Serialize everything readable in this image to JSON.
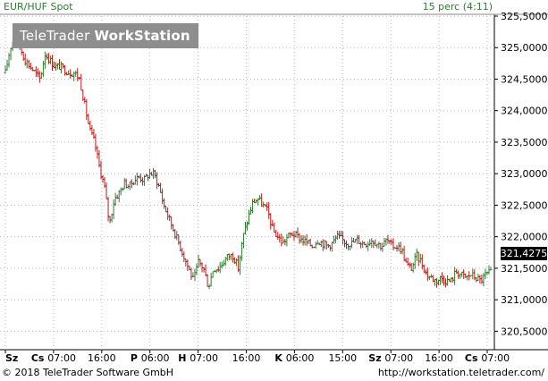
{
  "header": {
    "instrument": "EUR/HUF Spot",
    "interval": "15 perc (4:11)"
  },
  "watermark": {
    "brand": "TeleTrader",
    "product": "WorkStation"
  },
  "footer": {
    "copyright": "© 2018 TeleTrader Software GmbH",
    "url": "http://workstation.teletrader.com/"
  },
  "colors": {
    "up_bar": "#2e7d32",
    "down_bar": "#b71c1c",
    "grid": "#b8b8b8",
    "watermark_bg": "#8e8e8e",
    "last_price_box": "#000000"
  },
  "chart_data": {
    "type": "ohlc",
    "title": "EUR/HUF Spot",
    "xlabel": "",
    "ylabel": "",
    "ylim": [
      320.25,
      325.5
    ],
    "y_ticks": [
      "325,5000",
      "325,0000",
      "324,5000",
      "324,0000",
      "323,5000",
      "323,0000",
      "322,5000",
      "322,0000",
      "321,5000",
      "321,0000",
      "320,5000"
    ],
    "y_tick_values": [
      325.5,
      325.0,
      324.5,
      324.0,
      323.5,
      323.0,
      322.5,
      322.0,
      321.5,
      321.0,
      320.5
    ],
    "x_tick_labels": [
      {
        "day": "Sz",
        "time": ""
      },
      {
        "day": "Cs",
        "time": "07:00"
      },
      {
        "day": "",
        "time": "16:00"
      },
      {
        "day": "P",
        "time": "06:00"
      },
      {
        "day": "H",
        "time": "07:00"
      },
      {
        "day": "",
        "time": "16:00"
      },
      {
        "day": "K",
        "time": "06:00"
      },
      {
        "day": "",
        "time": "15:00"
      },
      {
        "day": "Sz",
        "time": "07:00"
      },
      {
        "day": "",
        "time": "16:00"
      },
      {
        "day": "Cs",
        "time": "07:00"
      }
    ],
    "last_value": "321,4275",
    "grid": true,
    "series": [
      {
        "close_path": [
          [
            0,
            324.6
          ],
          [
            1,
            325.0
          ],
          [
            2,
            325.2
          ],
          [
            3,
            325.0
          ],
          [
            4,
            324.8
          ],
          [
            5,
            324.7
          ],
          [
            6,
            324.6
          ],
          [
            7,
            324.5
          ],
          [
            8,
            324.9
          ],
          [
            9,
            324.8
          ],
          [
            10,
            324.7
          ],
          [
            11,
            324.7
          ],
          [
            12,
            324.65
          ],
          [
            13,
            324.6
          ],
          [
            14,
            324.6
          ],
          [
            15,
            324.5
          ],
          [
            16,
            324.1
          ],
          [
            17,
            323.7
          ],
          [
            18,
            323.5
          ],
          [
            19,
            323.1
          ],
          [
            20,
            322.8
          ],
          [
            21,
            322.2
          ],
          [
            22,
            322.6
          ],
          [
            23,
            322.7
          ],
          [
            24,
            322.85
          ],
          [
            25,
            322.8
          ],
          [
            26,
            322.9
          ],
          [
            27,
            322.95
          ],
          [
            28,
            322.9
          ],
          [
            29,
            323.0
          ],
          [
            30,
            323.0
          ],
          [
            31,
            322.8
          ],
          [
            32,
            322.5
          ],
          [
            33,
            322.3
          ],
          [
            34,
            322.1
          ],
          [
            35,
            321.9
          ],
          [
            36,
            321.7
          ],
          [
            37,
            321.5
          ],
          [
            38,
            321.3
          ],
          [
            39,
            321.6
          ],
          [
            40,
            321.5
          ],
          [
            41,
            321.2
          ],
          [
            42,
            321.5
          ],
          [
            43,
            321.5
          ],
          [
            44,
            321.6
          ],
          [
            45,
            321.7
          ],
          [
            46,
            321.7
          ],
          [
            47,
            321.5
          ],
          [
            48,
            322.0
          ],
          [
            49,
            322.3
          ],
          [
            50,
            322.55
          ],
          [
            51,
            322.6
          ],
          [
            52,
            322.5
          ],
          [
            53,
            322.4
          ],
          [
            54,
            322.1
          ],
          [
            55,
            322.0
          ],
          [
            56,
            321.9
          ],
          [
            57,
            322.0
          ],
          [
            58,
            322.05
          ],
          [
            59,
            322.0
          ],
          [
            60,
            321.95
          ],
          [
            61,
            321.9
          ],
          [
            62,
            321.85
          ],
          [
            63,
            321.95
          ],
          [
            64,
            321.9
          ],
          [
            65,
            321.85
          ],
          [
            66,
            321.9
          ],
          [
            67,
            322.0
          ],
          [
            68,
            321.95
          ],
          [
            69,
            321.9
          ],
          [
            70,
            321.9
          ],
          [
            71,
            321.95
          ],
          [
            72,
            321.9
          ],
          [
            73,
            321.9
          ],
          [
            74,
            321.95
          ],
          [
            75,
            321.9
          ],
          [
            76,
            321.85
          ],
          [
            77,
            321.95
          ],
          [
            78,
            321.85
          ],
          [
            79,
            321.85
          ],
          [
            80,
            321.8
          ],
          [
            81,
            321.55
          ],
          [
            82,
            321.5
          ],
          [
            83,
            321.7
          ],
          [
            84,
            321.6
          ],
          [
            85,
            321.4
          ],
          [
            86,
            321.35
          ],
          [
            87,
            321.3
          ],
          [
            88,
            321.35
          ],
          [
            89,
            321.3
          ],
          [
            90,
            321.3
          ],
          [
            91,
            321.45
          ],
          [
            92,
            321.4
          ],
          [
            93,
            321.35
          ],
          [
            94,
            321.4
          ],
          [
            95,
            321.35
          ],
          [
            96,
            321.3
          ],
          [
            97,
            321.4
          ],
          [
            98,
            321.43
          ]
        ]
      }
    ]
  }
}
